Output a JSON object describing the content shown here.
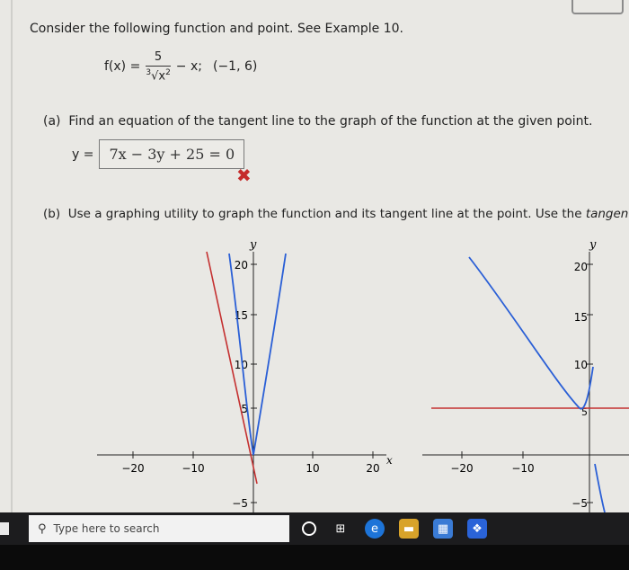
{
  "question": {
    "intro": "Consider the following function and point. See Example 10.",
    "function_lhs": "f(x) =",
    "function_numerator": "5",
    "function_root_index": "3",
    "function_radicand": "x",
    "function_exponent": "2",
    "function_rest": "− x;",
    "point": "(−1, 6)"
  },
  "part_a": {
    "label": "(a)",
    "prompt": "Find an equation of the tangent line to the graph of the function at the given point.",
    "y_label": "y =",
    "answer": "7x − 3y + 25 = 0",
    "status_mark": "✖"
  },
  "part_b": {
    "label": "(b)",
    "prompt": "Use a graphing utility to graph the function and its tangent line at the point. Use the",
    "prompt_italic": "tangent fea"
  },
  "graphs": [
    {
      "y_axis_label": "y",
      "x_axis_label": "x",
      "y_ticks": [
        "20",
        "15",
        "10",
        "5",
        "−5"
      ],
      "x_ticks": [
        "−20",
        "−10",
        "10",
        "20"
      ]
    },
    {
      "y_axis_label": "y",
      "y_ticks": [
        "20",
        "15",
        "10",
        "5",
        "−5"
      ],
      "x_ticks": [
        "−20",
        "−10"
      ]
    }
  ],
  "taskbar": {
    "search_placeholder": "Type here to search"
  },
  "colors": {
    "curve": "#2a5fd6",
    "tangent": "#c43030",
    "error": "#c52b2b"
  }
}
